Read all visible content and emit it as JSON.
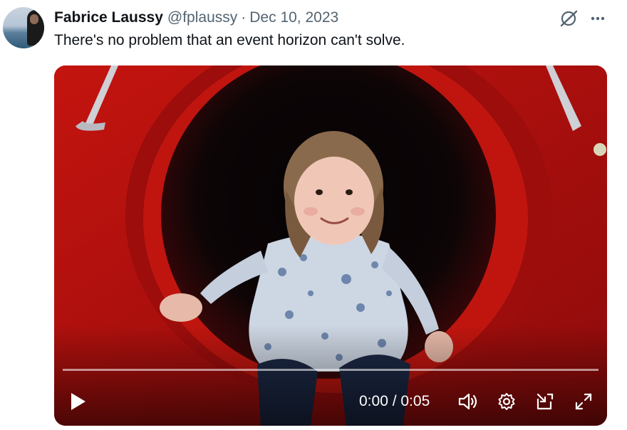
{
  "tweet": {
    "author_name": "Fabrice Laussy",
    "author_handle": "@fplaussy",
    "separator": "·",
    "date": "Dec 10, 2023",
    "text": "There's no problem that an event horizon can't solve."
  },
  "header_actions": {
    "grok_icon": "grok-icon",
    "more_icon": "more-icon"
  },
  "video": {
    "time_display": "0:00 / 0:05",
    "progress": 0.0,
    "controls": [
      "play-icon",
      "volume-icon",
      "settings-icon",
      "picture-in-picture-icon",
      "fullscreen-icon"
    ]
  },
  "colors": {
    "text_primary": "#0f1419",
    "text_secondary": "#536471",
    "accent": "#1d9bf0"
  }
}
